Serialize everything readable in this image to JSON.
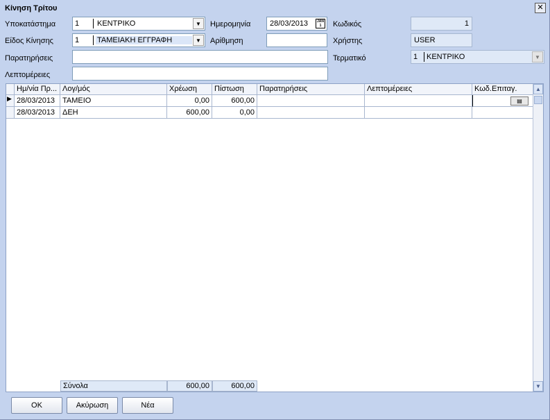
{
  "window": {
    "title": "Κίνηση Τρίτου",
    "close_label": "✕"
  },
  "form": {
    "branch": {
      "label": "Υποκατάστημα",
      "code": "1",
      "text": "ΚΕΝΤΡΙΚΟ"
    },
    "movement_type": {
      "label": "Είδος Κίνησης",
      "code": "1",
      "text": "ΤΑΜΕΙΑΚΗ ΕΓΓΡΑΦΗ"
    },
    "date": {
      "label": "Ημερομηνία",
      "value": "28/03/2013",
      "cal_top": "JAN",
      "cal_day": "1"
    },
    "number": {
      "label": "Αρίθμηση",
      "value": ""
    },
    "code": {
      "label": "Κωδικός",
      "value": "1"
    },
    "user": {
      "label": "Χρήστης",
      "value": "USER"
    },
    "notes": {
      "label": "Παρατηρήσεις",
      "value": ""
    },
    "terminal": {
      "label": "Τερματικό",
      "code": "1",
      "text": "ΚΕΝΤΡΙΚΟ"
    },
    "details": {
      "label": "Λεπτομέρειες",
      "value": ""
    }
  },
  "grid": {
    "columns": [
      "Ημ/νία Πρ...",
      "Λογ/μός",
      "Χρέωση",
      "Πίστωση",
      "Παρατηρήσεις",
      "Λεπτομέρειες",
      "Κωδ.Επιταγ."
    ],
    "rows": [
      {
        "date": "28/03/2013",
        "account": "ΤΑΜΕΙΟ",
        "debit": "0,00",
        "credit": "600,00",
        "notes": "",
        "details": "",
        "check": ""
      },
      {
        "date": "28/03/2013",
        "account": "ΔΕΗ",
        "debit": "600,00",
        "credit": "0,00",
        "notes": "",
        "details": "",
        "check": ""
      }
    ],
    "totals": {
      "label": "Σύνολα",
      "debit": "600,00",
      "credit": "600,00"
    },
    "current_row_marker": "▶"
  },
  "buttons": {
    "ok": "OK",
    "cancel": "Ακύρωση",
    "new": "Νέα"
  }
}
